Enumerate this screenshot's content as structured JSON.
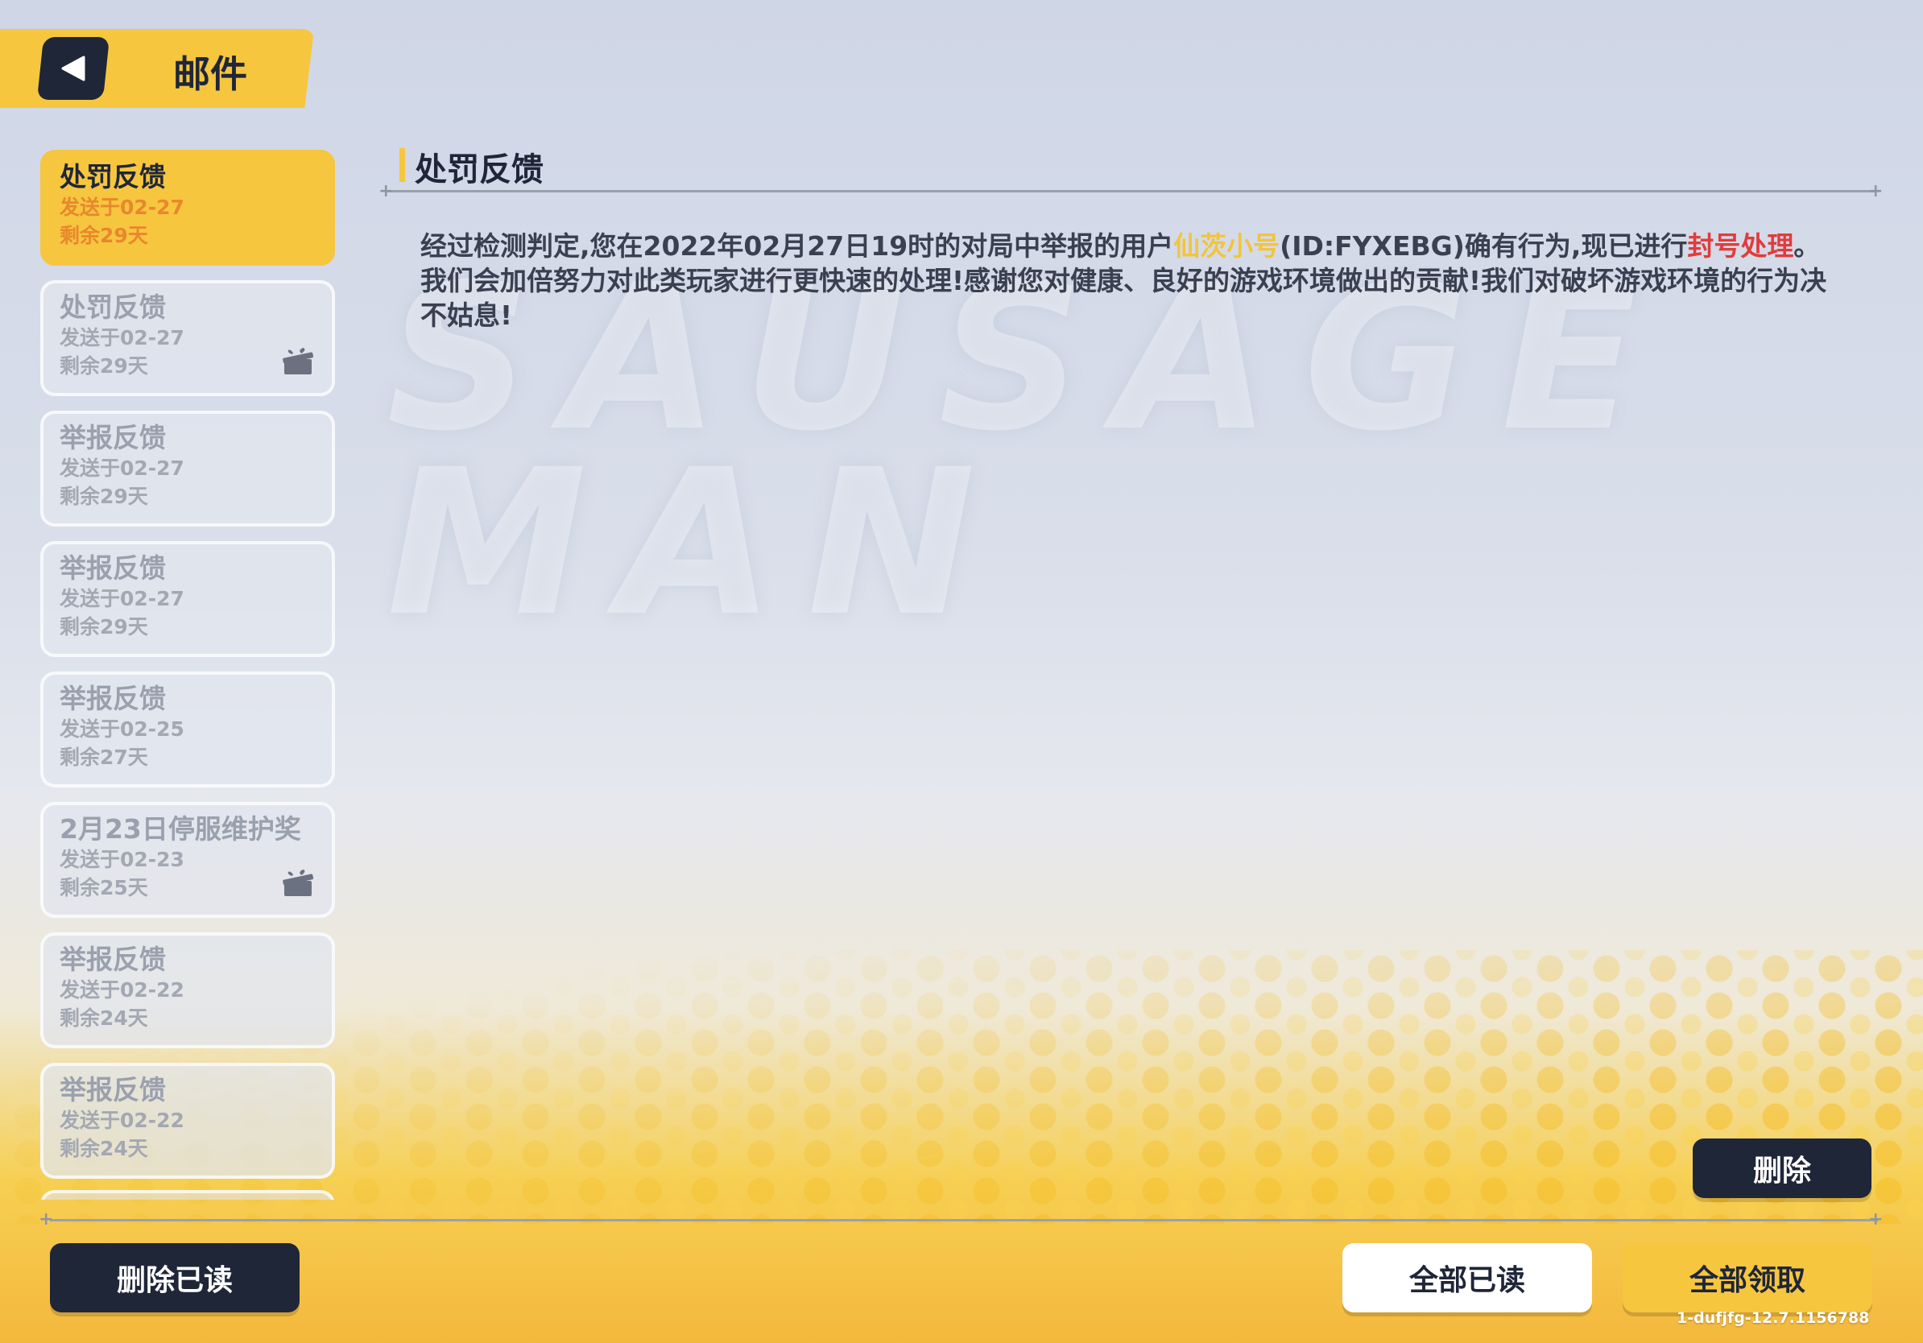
{
  "header": {
    "title": "邮件"
  },
  "background": {
    "logo_text": "SAUSAGE MAN"
  },
  "mail_list": [
    {
      "title": "处罚反馈",
      "sent": "发送于02-27",
      "remaining": "剩余29天",
      "has_gift": false,
      "selected": true
    },
    {
      "title": "处罚反馈",
      "sent": "发送于02-27",
      "remaining": "剩余29天",
      "has_gift": true,
      "selected": false
    },
    {
      "title": "举报反馈",
      "sent": "发送于02-27",
      "remaining": "剩余29天",
      "has_gift": false,
      "selected": false
    },
    {
      "title": "举报反馈",
      "sent": "发送于02-27",
      "remaining": "剩余29天",
      "has_gift": false,
      "selected": false
    },
    {
      "title": "举报反馈",
      "sent": "发送于02-25",
      "remaining": "剩余27天",
      "has_gift": false,
      "selected": false
    },
    {
      "title": "2月23日停服维护奖",
      "sent": "发送于02-23",
      "remaining": "剩余25天",
      "has_gift": true,
      "selected": false
    },
    {
      "title": "举报反馈",
      "sent": "发送于02-22",
      "remaining": "剩余24天",
      "has_gift": false,
      "selected": false
    },
    {
      "title": "举报反馈",
      "sent": "发送于02-22",
      "remaining": "剩余24天",
      "has_gift": false,
      "selected": false
    }
  ],
  "content": {
    "title": "处罚反馈",
    "body_part1": "经过检测判定,您在2022年02月27日19时的对局中举报的用户",
    "body_user": "仙茨小号",
    "body_part2": "(ID:FYXEBG)确有行为,现已进行",
    "body_action": "封号处理",
    "body_part3": "。我们会加倍努力对此类玩家进行更快速的处理!感谢您对健康、良好的游戏环境做出的贡献!我们对破坏游戏环境的行为决不姑息!"
  },
  "buttons": {
    "delete": "删除",
    "delete_read": "删除已读",
    "read_all": "全部已读",
    "claim_all": "全部领取"
  },
  "version": "1-dufjfg-12.7.1156788",
  "colors": {
    "accent_yellow": "#f6c63f",
    "dark_navy": "#1f2638",
    "highlight_red": "#e23b3b"
  }
}
